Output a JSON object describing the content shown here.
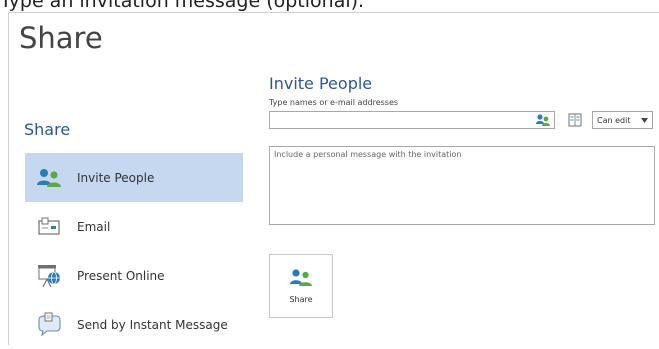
{
  "caption": "Type an invitation message (optional).",
  "page": {
    "title": "Share"
  },
  "sidebar": {
    "heading": "Share",
    "items": [
      {
        "label": "Invite People",
        "icon": "people-icon",
        "active": true
      },
      {
        "label": "Email",
        "icon": "email-icon",
        "active": false
      },
      {
        "label": "Present Online",
        "icon": "present-online-icon",
        "active": false
      },
      {
        "label": "Send by Instant Message",
        "icon": "instant-message-icon",
        "active": false
      }
    ]
  },
  "invite": {
    "title": "Invite People",
    "names_label": "Type names or e-mail addresses",
    "names_value": "",
    "permission": "Can edit",
    "message_placeholder": "Include a personal message with the invitation",
    "message_value": "",
    "share_label": "Share"
  },
  "colors": {
    "accent": "#2b5797",
    "active_bg": "#c6d7f0"
  }
}
